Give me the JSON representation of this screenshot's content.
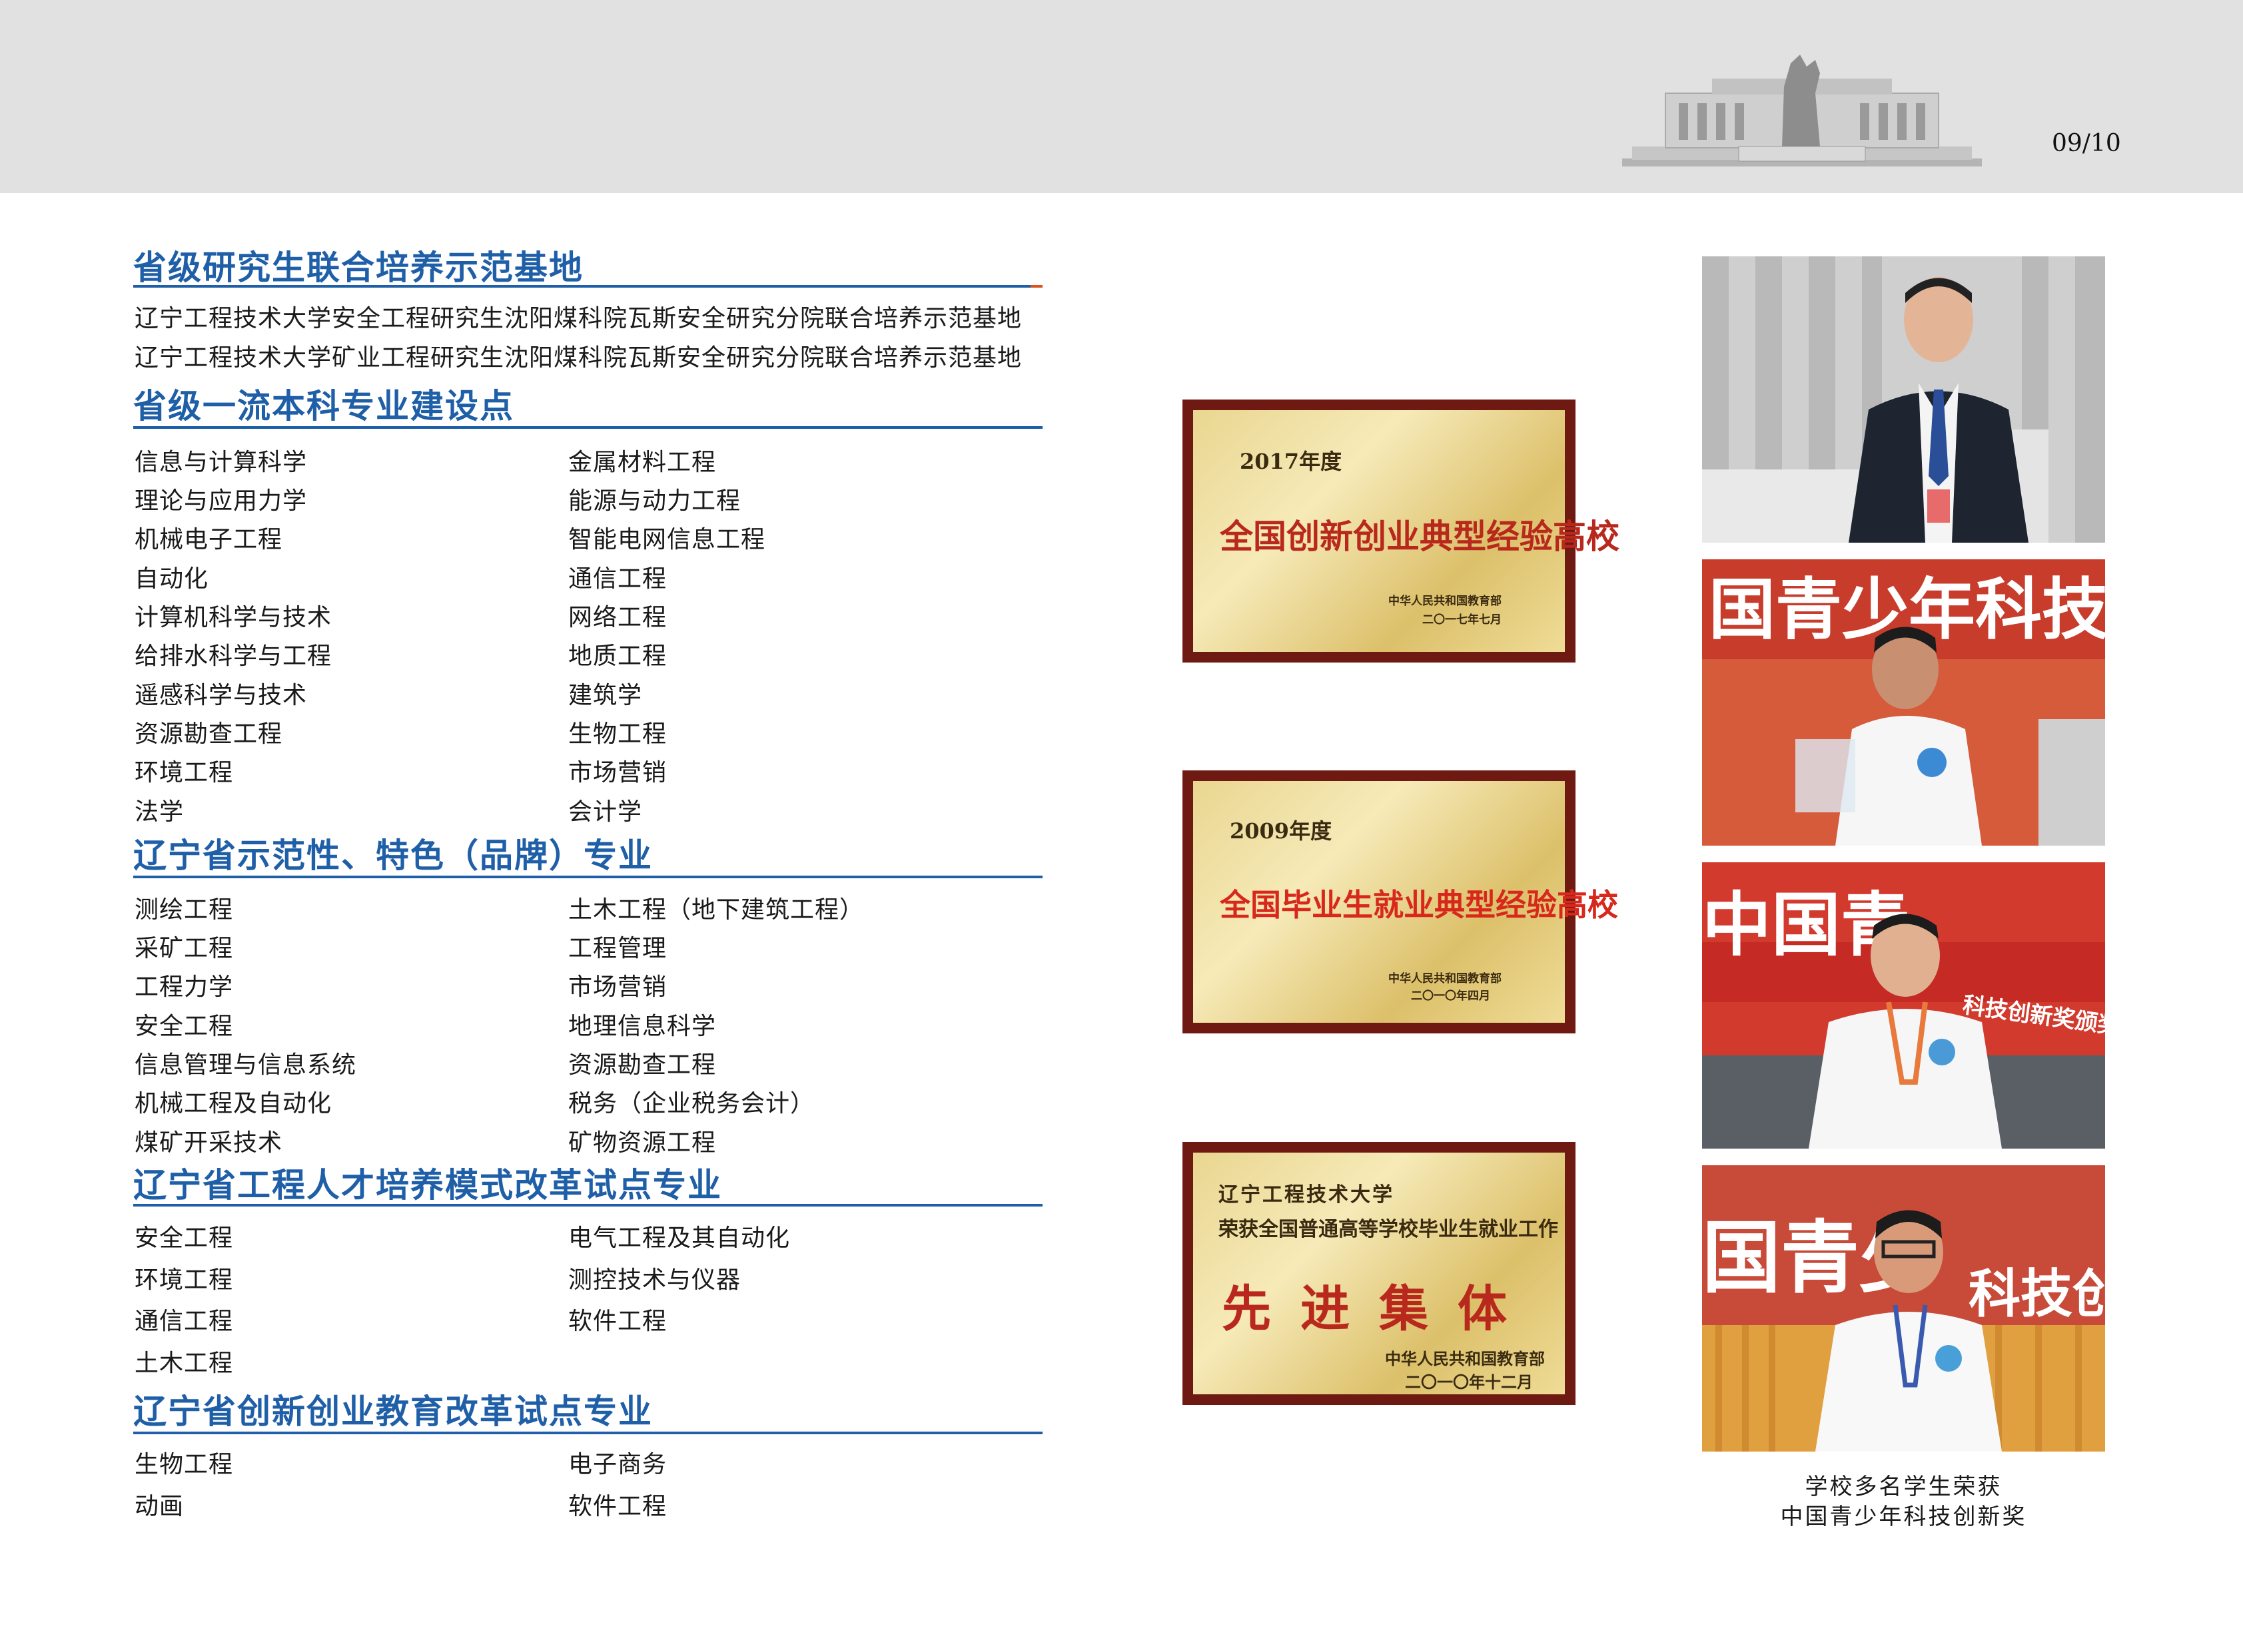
{
  "header": {
    "page_number": "09/10"
  },
  "sections": [
    {
      "title": "省级研究生联合培养示范基地",
      "lines": [
        "辽宁工程技术大学安全工程研究生沈阳煤科院瓦斯安全研究分院联合培养示范基地",
        "辽宁工程技术大学矿业工程研究生沈阳煤科院瓦斯安全研究分院联合培养示范基地"
      ]
    },
    {
      "title": "省级一流本科专业建设点",
      "col1": [
        "信息与计算科学",
        "理论与应用力学",
        "机械电子工程",
        "自动化",
        "计算机科学与技术",
        "给排水科学与工程",
        "遥感科学与技术",
        "资源勘查工程",
        "环境工程",
        "法学"
      ],
      "col2": [
        "金属材料工程",
        "能源与动力工程",
        "智能电网信息工程",
        "通信工程",
        "网络工程",
        "地质工程",
        "建筑学",
        "生物工程",
        "市场营销",
        "会计学"
      ]
    },
    {
      "title": "辽宁省示范性、特色（品牌）专业",
      "col1": [
        "测绘工程",
        "采矿工程",
        "工程力学",
        "安全工程",
        "信息管理与信息系统",
        "机械工程及自动化",
        "煤矿开采技术"
      ],
      "col2": [
        "土木工程（地下建筑工程）",
        "工程管理",
        "市场营销",
        "地理信息科学",
        "资源勘查工程",
        "税务（企业税务会计）",
        "矿物资源工程"
      ]
    },
    {
      "title": "辽宁省工程人才培养模式改革试点专业",
      "col1": [
        "安全工程",
        "环境工程",
        "通信工程",
        "土木工程"
      ],
      "col2": [
        "电气工程及其自动化",
        "测控技术与仪器",
        "软件工程"
      ]
    },
    {
      "title": "辽宁省创新创业教育改革试点专业",
      "col1": [
        "生物工程",
        "动画"
      ],
      "col2": [
        "电子商务",
        "软件工程"
      ]
    }
  ],
  "plaques": [
    {
      "year": "2017年度",
      "title": "全国创新创业典型经验高校",
      "issuer": "中华人民共和国教育部",
      "date": "二〇一七年七月",
      "title_color": "#b8281c"
    },
    {
      "year": "2009年度",
      "title": "全国毕业生就业典型经验高校",
      "issuer": "中华人民共和国教育部",
      "date": "二〇一〇年四月",
      "title_color": "#d8281c"
    },
    {
      "line1": "辽宁工程技术大学",
      "line2": "荣获全国普通高等学校毕业生就业工作",
      "title": "先进集体",
      "issuer": "中华人民共和国教育部",
      "date": "二〇一〇年十二月"
    }
  ],
  "photos": {
    "banner_texts": [
      "国青少年科技创新",
      "中国青",
      "科技创新奖颁奖大会",
      "国青少",
      "科技创新"
    ],
    "caption_line1": "学校多名学生荣获",
    "caption_line2": "中国青少年科技创新奖"
  },
  "colors": {
    "heading": "#1f5fa8",
    "accent": "#d9541e",
    "header_band": "#e1e1e1",
    "plaque_frame": "#6e1a12"
  }
}
